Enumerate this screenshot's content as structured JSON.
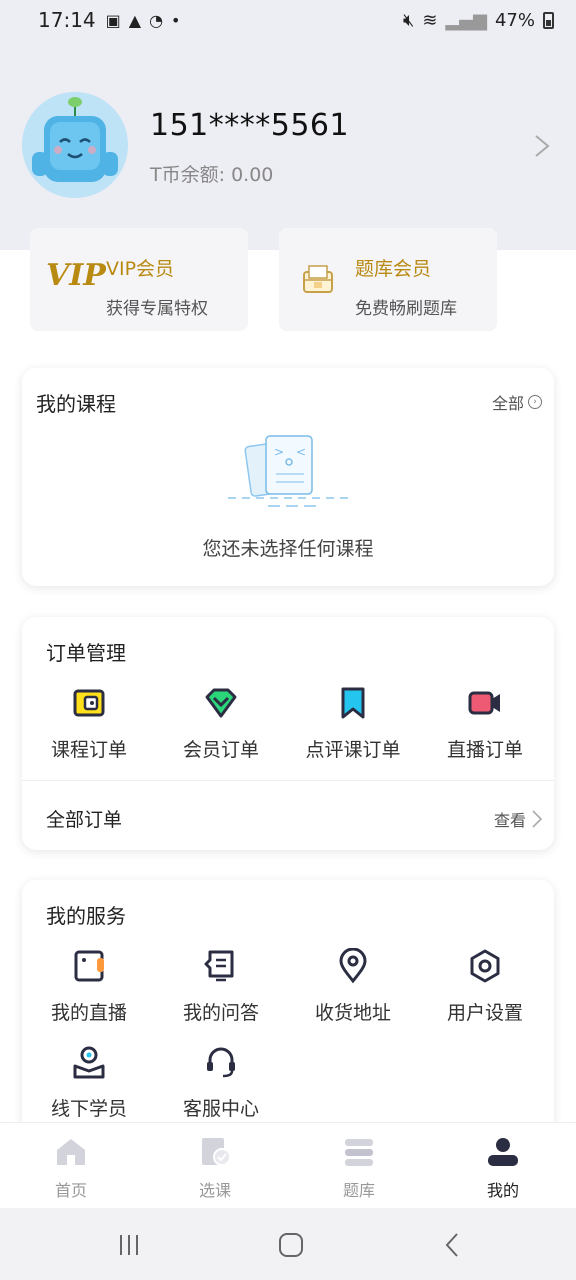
{
  "status_bar": {
    "time": "17:14",
    "battery": "47%"
  },
  "profile": {
    "phone": "151****5561",
    "balance_label": "T币余额:",
    "balance_value": "0.00"
  },
  "members": [
    {
      "title": "VIP会员",
      "subtitle": "获得专属特权",
      "logo_text": "VIP"
    },
    {
      "title": "题库会员",
      "subtitle": "免费畅刷题库"
    }
  ],
  "courses": {
    "title": "我的课程",
    "more_label": "全部",
    "empty_text": "您还未选择任何课程"
  },
  "orders": {
    "title": "订单管理",
    "items": [
      {
        "label": "课程订单",
        "icon": "course-order-icon"
      },
      {
        "label": "会员订单",
        "icon": "member-order-icon"
      },
      {
        "label": "点评课订单",
        "icon": "review-order-icon"
      },
      {
        "label": "直播订单",
        "icon": "live-order-icon"
      }
    ],
    "all_label": "全部订单",
    "view_label": "查看"
  },
  "services": {
    "title": "我的服务",
    "items": [
      {
        "label": "我的直播",
        "icon": "live-icon"
      },
      {
        "label": "我的问答",
        "icon": "qa-icon"
      },
      {
        "label": "收货地址",
        "icon": "location-icon"
      },
      {
        "label": "用户设置",
        "icon": "settings-icon"
      },
      {
        "label": "线下学员",
        "icon": "offline-student-icon"
      },
      {
        "label": "客服中心",
        "icon": "headset-icon"
      }
    ]
  },
  "bottom_nav": {
    "items": [
      {
        "label": "首页",
        "icon": "home-icon"
      },
      {
        "label": "选课",
        "icon": "course-select-icon"
      },
      {
        "label": "题库",
        "icon": "question-bank-icon"
      },
      {
        "label": "我的",
        "icon": "profile-icon",
        "active": true
      }
    ]
  },
  "colors": {
    "header_bg": "#ededf4",
    "gold": "#b98a12",
    "accent_yellow": "#ffe01a",
    "accent_green": "#2bd67b",
    "accent_cyan": "#24c6f0",
    "accent_red": "#ee5a73",
    "dark": "#2b2d42"
  }
}
